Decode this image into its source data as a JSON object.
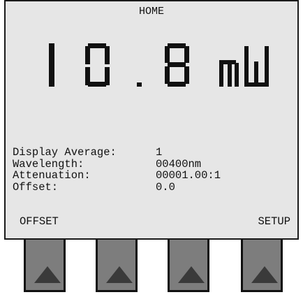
{
  "screen": {
    "title": "HOME",
    "reading": {
      "value": "10.8",
      "unit": "mW"
    },
    "info": [
      {
        "label": "Display Average:",
        "value": "1"
      },
      {
        "label": "Wavelength:",
        "value": "00400nm"
      },
      {
        "label": "Attenuation:",
        "value": "00001.00:1"
      },
      {
        "label": "Offset:",
        "value": "0.0"
      }
    ],
    "softkeys": {
      "left": "OFFSET",
      "right": "SETUP"
    }
  },
  "buttons": [
    {
      "icon": "up-arrow-icon"
    },
    {
      "icon": "up-arrow-icon"
    },
    {
      "icon": "up-arrow-icon"
    },
    {
      "icon": "up-arrow-icon"
    }
  ],
  "colors": {
    "screen_bg": "#e6e6e6",
    "button_bg": "#7d7d7d",
    "arrow": "#3a3a3a",
    "text": "#111111"
  }
}
